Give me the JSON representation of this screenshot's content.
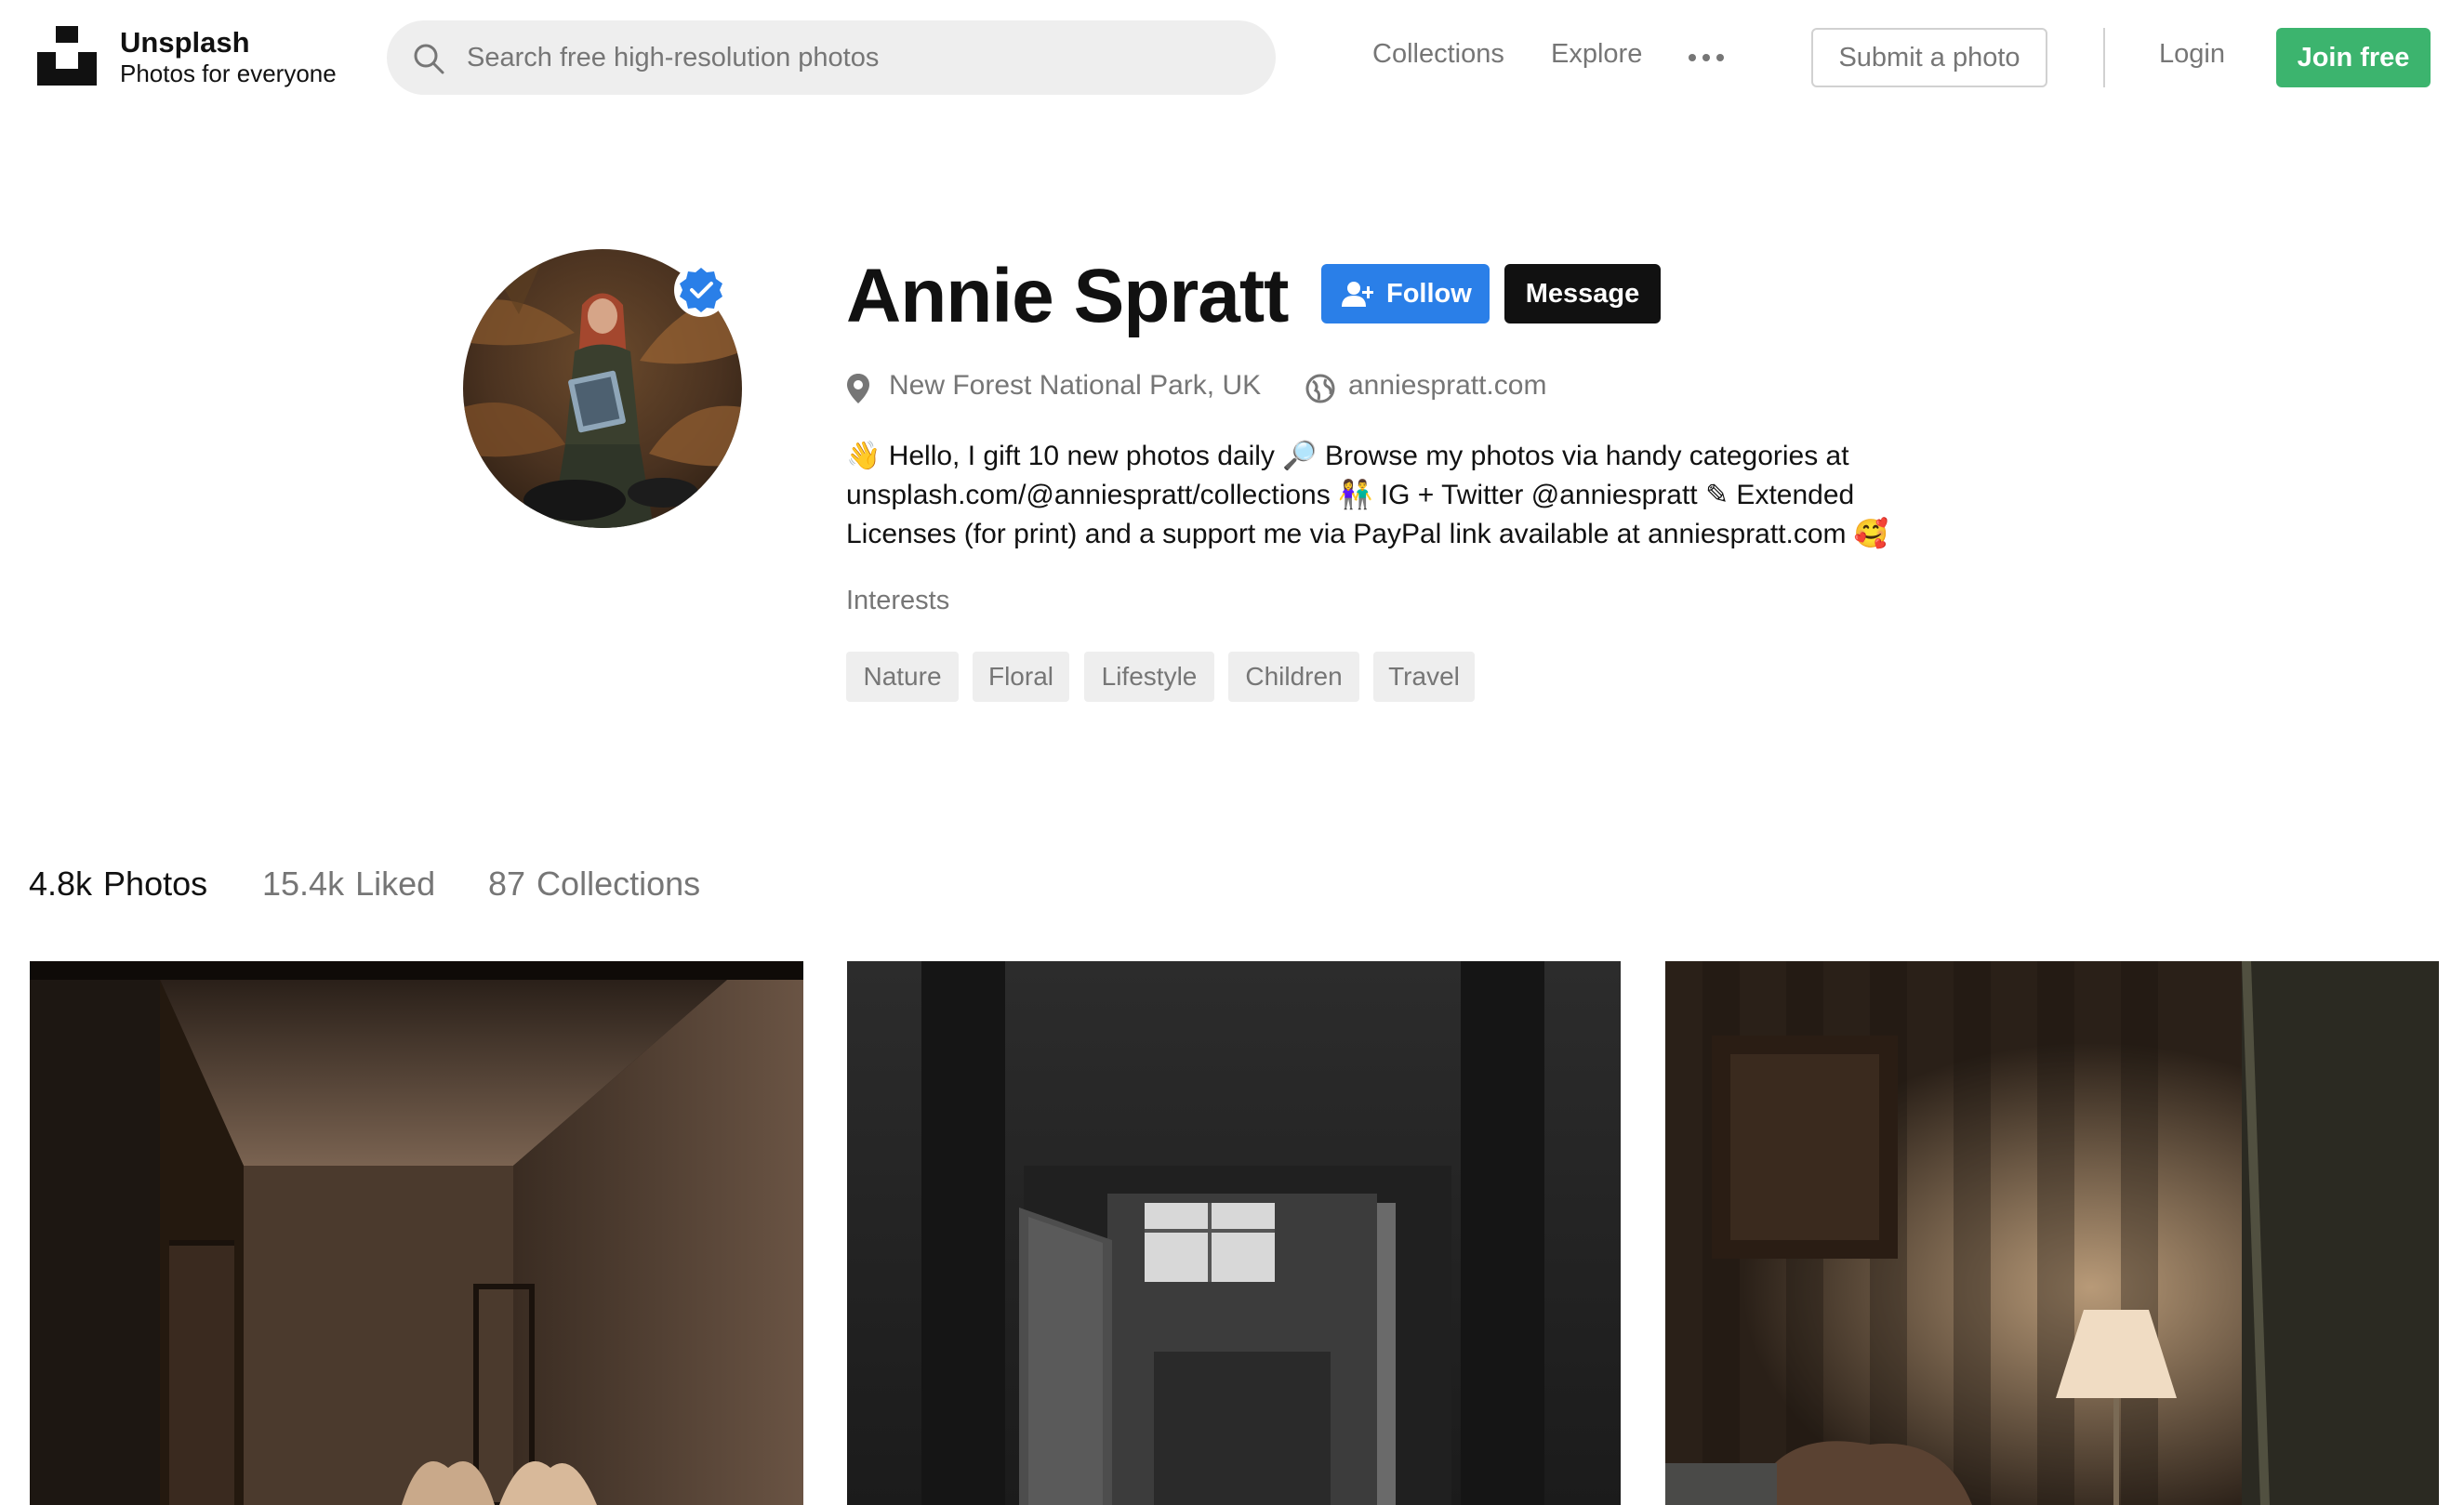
{
  "header": {
    "brand_name": "Unsplash",
    "tagline": "Photos for everyone",
    "search_placeholder": "Search free high-resolution photos",
    "nav": {
      "collections": "Collections",
      "explore": "Explore",
      "more_icon": "more-horizontal-icon"
    },
    "submit_label": "Submit a photo",
    "login_label": "Login",
    "join_label": "Join free",
    "join_color": "#3cb46e"
  },
  "profile": {
    "name": "Annie Spratt",
    "verified_icon": "verified-badge-icon",
    "follow_label": "Follow",
    "follow_color": "#2a7fe8",
    "message_label": "Message",
    "location": "New Forest National Park, UK",
    "website": "anniespratt.com",
    "bio_lines": [
      "👋 Hello, I gift 10 new photos daily 🔎 Browse my photos via handy categories at",
      "unsplash.com/@anniespratt/collections 👫 IG + Twitter @anniespratt ✎ Extended",
      "Licenses (for print) and a support me via PayPal link available at anniespratt.com 🥰"
    ],
    "interests_label": "Interests",
    "interests": [
      "Nature",
      "Floral",
      "Lifestyle",
      "Children",
      "Travel"
    ]
  },
  "tabs": [
    {
      "count": "4.8k",
      "label": "Photos",
      "active": true
    },
    {
      "count": "15.4k",
      "label": "Liked",
      "active": false
    },
    {
      "count": "87",
      "label": "Collections",
      "active": false
    }
  ],
  "photos": [
    {
      "name": "bedroom-floral-wallpaper-photo"
    },
    {
      "name": "dark-doorway-window-photo"
    },
    {
      "name": "striped-room-lamp-photo"
    }
  ]
}
